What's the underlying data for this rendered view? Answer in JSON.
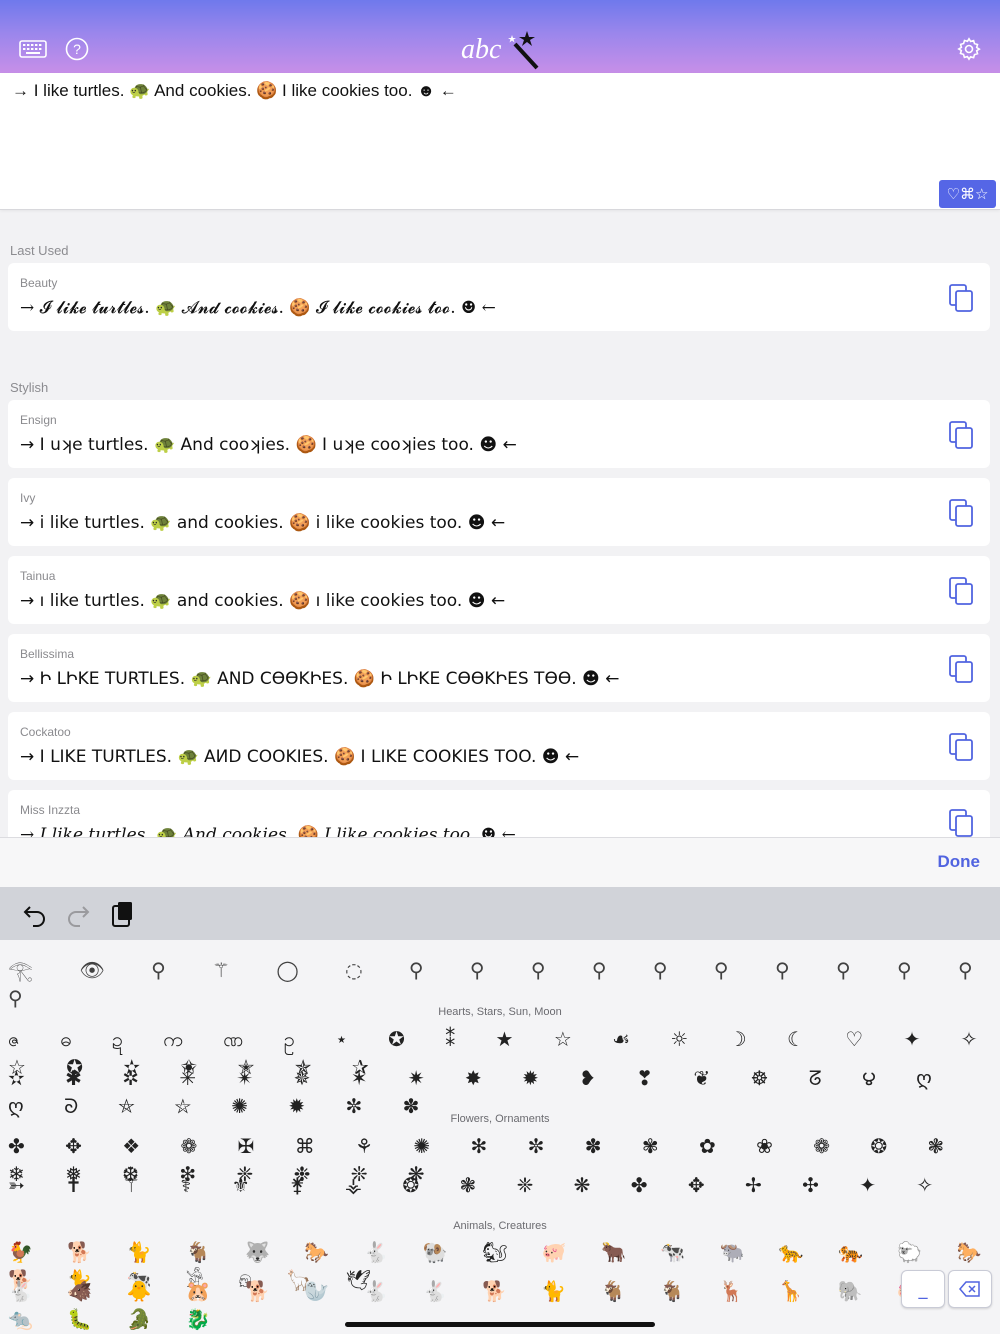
{
  "header": {
    "logo_text": "abc",
    "icons": [
      "keyboard-icon",
      "help-icon",
      "settings-icon"
    ],
    "gradient": [
      "#6f79ec",
      "#c78fe8"
    ]
  },
  "editor": {
    "text": "→ I like turtles. 🐢 And cookies. 🍪 I like cookies too. ☻ ←",
    "fav_symbols": "♡⌘☆"
  },
  "sections": {
    "last_used": "Last Used",
    "stylish": "Stylish"
  },
  "last_used": [
    {
      "name": "Beauty",
      "text": "→ 𝓘 𝓵𝓲𝓴𝓮 𝓽𝓾𝓻𝓽𝓵𝓮𝓼. 🐢 𝓐𝓷𝓭 𝓬𝓸𝓸𝓴𝓲𝓮𝓼. 🍪 𝓘 𝓵𝓲𝓴𝓮 𝓬𝓸𝓸𝓴𝓲𝓮𝓼 𝓽𝓸𝓸. ☻ ←"
    }
  ],
  "stylish": [
    {
      "name": "Ensign",
      "text": "→ I uʞe turtles. 🐢 And cooʞies. 🍪 I uʞe cooʞies too. ☻ ←"
    },
    {
      "name": "Ivy",
      "text": "→ i like turtles. 🐢 and cookies. 🍪 i like cookies too. ☻ ←"
    },
    {
      "name": "Tainua",
      "text": "→ ı like turtles. 🐢 and cookies. 🍪 ı like cookies too. ☻ ←"
    },
    {
      "name": "Bellissima",
      "text": "→ Ի ԼԻKE TURTLES. 🐢 AND CӨӨKԻES. 🍪 Ի ԼԻKE CӨӨKԻES TӨӨ. ☻ ←"
    },
    {
      "name": "Cockatoo",
      "text": "→ I LIKE TURTLES. 🐢 AИD COOKIES. 🍪 I LIKE COOKIES TOO. ☻ ←"
    },
    {
      "name": "Miss Inzzta",
      "text": "→ 𝐼 𝑙𝑖𝑘𝑒 𝑡𝑢𝑟𝑡𝑙𝑒𝑠. 🐢 𝐴𝑛𝑑 𝑐𝑜𝑜𝑘𝑖𝑒𝑠. 🍪 𝐼 𝑙𝑖𝑘𝑒 𝑐𝑜𝑜𝑘𝑖𝑒𝑠 𝑡𝑜𝑜. ☻ ←"
    }
  ],
  "done_bar": {
    "done_label": "Done"
  },
  "toolbar": {
    "icons": [
      "undo-icon",
      "redo-icon",
      "paste-icon"
    ]
  },
  "keyboard": {
    "row_people": "𓂀 👁 ⚲ ⚚ ◯ ◌ ⚲ ⚲ ⚲ ⚲ ⚲ ⚲ ⚲ ⚲ ⚲ ⚲ ⚲",
    "hearts_title": "Hearts, Stars, Sun, Moon",
    "hearts_row1": "ဇ ဓ ဍ က ဏ ဥ ⋆ ✪ ⁑ ★ ☆ ☙ ☼ ☽ ☾ ♡ ✦ ✧ ☆ ✪ ✫ ✬ ✭ ✯ ✰",
    "hearts_row2": "✫ ✱ ✲ ✳ ✴ ✵ ✶ ✷ ✸ ✹ ❥ ❣ ❦ ☸ ᘔ ౪ ღ ღ ᘐ ⛤ ⛦ ✺ ✹ ✼ ✽",
    "flowers_title": "Flowers, Ornaments",
    "flowers_row1": "✤ ✥ ❖ ❁ ✠ ⌘ ⚘ ✺ ✻ ✼ ✽ ✾ ✿ ❀ ❁ ❂ ❃ ❄ ❅ ❆ ❇ ❈ ❉ ❊ ❋",
    "flowers_row2": "➳ ✝ ⚚ ⚕ ⚜ ⚵ ⚶ ❂ ❃ ❈ ❋ ✤ ✥ ✢ ✣ ✦ ✧",
    "animals_title": "Animals, Creatures",
    "animals_row1": "🐓 🐕 🐈 🐐 🐺 🐎 🐇 🐏 🐿 🐖 🐂 🐄 🐃 🐆 🐅 🐑 🐎 🐕 🐈 🐄 𓀀 𓁶 🦙 🕊",
    "animals_row2": "🐇 🐗 🐥 🐹 🐕 🦭 🐇 🐇 🐕 🐈 🐐 🐐 🦌 🦒 🐘 🐖 🐕 🐀 🐛 🐊 🐉",
    "key_space_label": "_",
    "backspace_icon": "backspace-icon"
  }
}
